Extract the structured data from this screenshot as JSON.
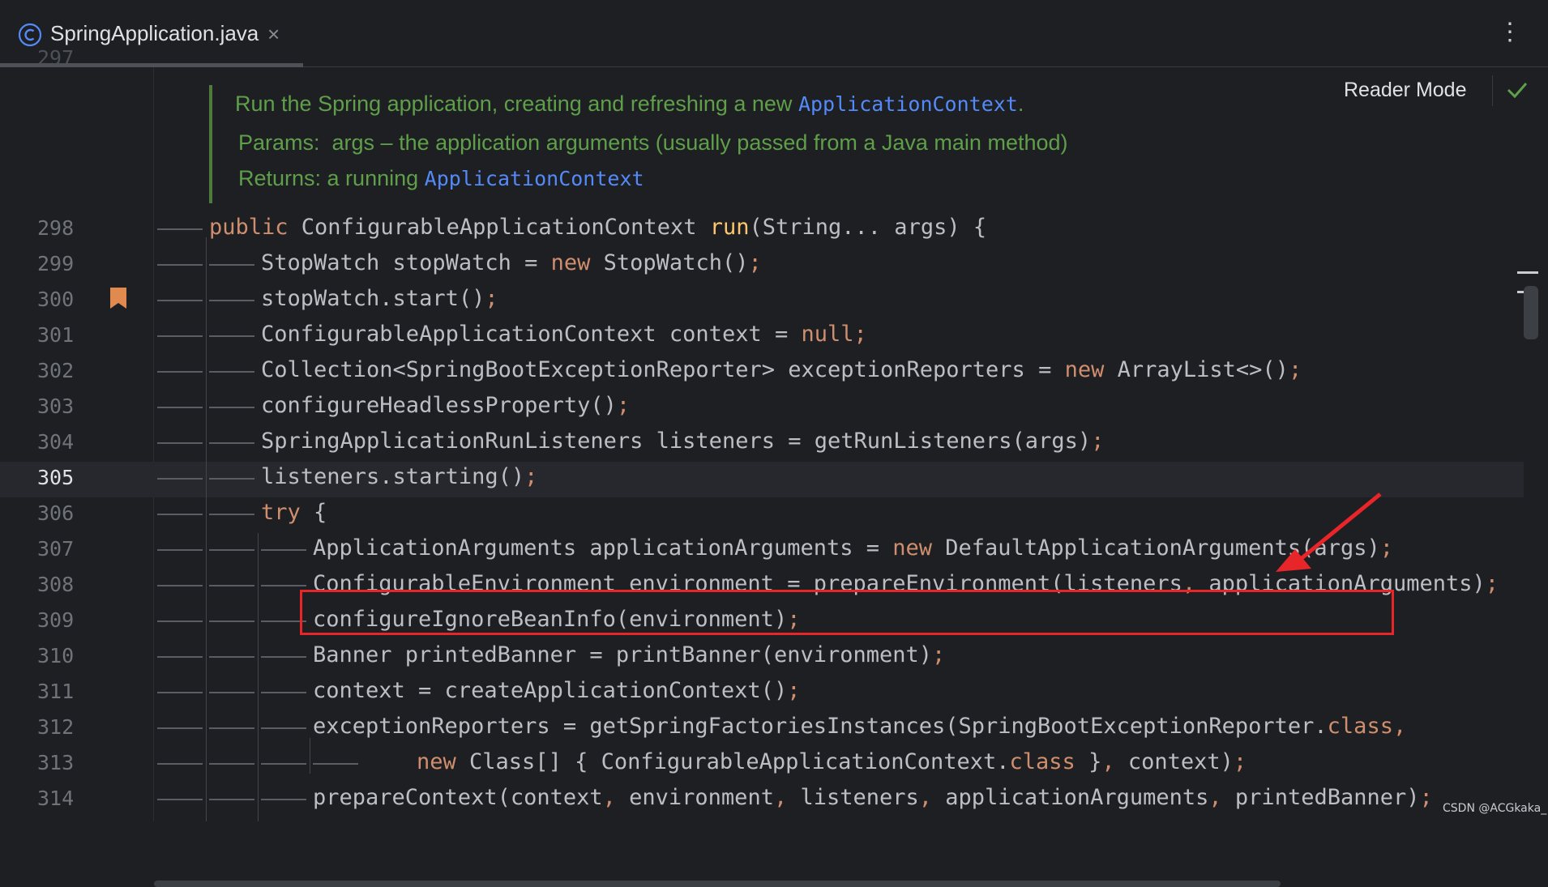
{
  "tab": {
    "title": "SpringApplication.java",
    "close": "×",
    "icon": "class-icon",
    "menu": "⋮"
  },
  "reader": {
    "label": "Reader Mode"
  },
  "doc": {
    "line1_text": "Run the Spring application, creating and refreshing a new ",
    "line1_code": "ApplicationContext",
    "line1_end": ".",
    "line2": "Params:  args – the application arguments (usually passed from a Java main method)",
    "line3_text": "Returns: a running ",
    "line3_code": "ApplicationContext"
  },
  "partial_line_number": "297",
  "lines": [
    {
      "n": "298",
      "tokens": [
        [
          "kw",
          "public "
        ],
        [
          "",
          "ConfigurableApplicationContext "
        ],
        [
          "fn",
          "run"
        ],
        [
          "",
          "(String... args) {"
        ]
      ]
    },
    {
      "n": "299",
      "tokens": [
        [
          "",
          "StopWatch stopWatch = "
        ],
        [
          "kw",
          "new "
        ],
        [
          "",
          "StopWatch()"
        ],
        [
          "kw",
          ";"
        ]
      ]
    },
    {
      "n": "300",
      "tokens": [
        [
          "",
          "stopWatch.start()"
        ],
        [
          "kw",
          ";"
        ]
      ]
    },
    {
      "n": "301",
      "tokens": [
        [
          "",
          "ConfigurableApplicationContext context = "
        ],
        [
          "kw",
          "null;"
        ]
      ]
    },
    {
      "n": "302",
      "tokens": [
        [
          "",
          "Collection<SpringBootExceptionReporter> exceptionReporters = "
        ],
        [
          "kw",
          "new "
        ],
        [
          "",
          "ArrayList<>()"
        ],
        [
          "kw",
          ";"
        ]
      ]
    },
    {
      "n": "303",
      "tokens": [
        [
          "",
          "configureHeadlessProperty()"
        ],
        [
          "kw",
          ";"
        ]
      ]
    },
    {
      "n": "304",
      "tokens": [
        [
          "",
          "SpringApplicationRunListeners listeners = getRunListeners(args)"
        ],
        [
          "kw",
          ";"
        ]
      ]
    },
    {
      "n": "305",
      "tokens": [
        [
          "",
          "listeners.starting()"
        ],
        [
          "kw",
          ";"
        ]
      ]
    },
    {
      "n": "306",
      "tokens": [
        [
          "kw",
          "try "
        ],
        [
          "",
          "{"
        ]
      ]
    },
    {
      "n": "307",
      "tokens": [
        [
          "",
          "ApplicationArguments applicationArguments = "
        ],
        [
          "kw",
          "new "
        ],
        [
          "",
          "DefaultApplicationArguments(args)"
        ],
        [
          "kw",
          ";"
        ]
      ]
    },
    {
      "n": "308",
      "tokens": [
        [
          "",
          "ConfigurableEnvironment environment = prepareEnvironment(listeners"
        ],
        [
          "kw",
          ", "
        ],
        [
          "",
          "applicationArguments)"
        ],
        [
          "kw",
          ";"
        ]
      ]
    },
    {
      "n": "309",
      "tokens": [
        [
          "",
          "configureIgnoreBeanInfo(environment)"
        ],
        [
          "kw",
          ";"
        ]
      ]
    },
    {
      "n": "310",
      "tokens": [
        [
          "",
          "Banner printedBanner = printBanner(environment)"
        ],
        [
          "kw",
          ";"
        ]
      ]
    },
    {
      "n": "311",
      "tokens": [
        [
          "",
          "context = createApplicationContext()"
        ],
        [
          "kw",
          ";"
        ]
      ]
    },
    {
      "n": "312",
      "tokens": [
        [
          "",
          "exceptionReporters = getSpringFactoriesInstances(SpringBootExceptionReporter."
        ],
        [
          "kw",
          "class,"
        ]
      ]
    },
    {
      "n": "313",
      "tokens": [
        [
          "kw",
          "new "
        ],
        [
          "",
          "Class[] { ConfigurableApplicationContext."
        ],
        [
          "kw",
          "class "
        ],
        [
          "",
          "}"
        ],
        [
          "kw",
          ", "
        ],
        [
          "",
          "context)"
        ],
        [
          "kw",
          ";"
        ]
      ]
    },
    {
      "n": "314",
      "tokens": [
        [
          "",
          "prepareContext(context"
        ],
        [
          "kw",
          ", "
        ],
        [
          "",
          "environment"
        ],
        [
          "kw",
          ", "
        ],
        [
          "",
          "listeners"
        ],
        [
          "kw",
          ", "
        ],
        [
          "",
          "applicationArguments"
        ],
        [
          "kw",
          ", "
        ],
        [
          "",
          "printedBanner)"
        ],
        [
          "kw",
          ";"
        ]
      ]
    }
  ],
  "watermark": "CSDN @ACGkaka_",
  "colors": {
    "background": "#1e1f22",
    "keyword": "#cf8e6d",
    "function": "#ffc66d",
    "doc": "#5f9f4a",
    "highlight": "#e8262a"
  }
}
